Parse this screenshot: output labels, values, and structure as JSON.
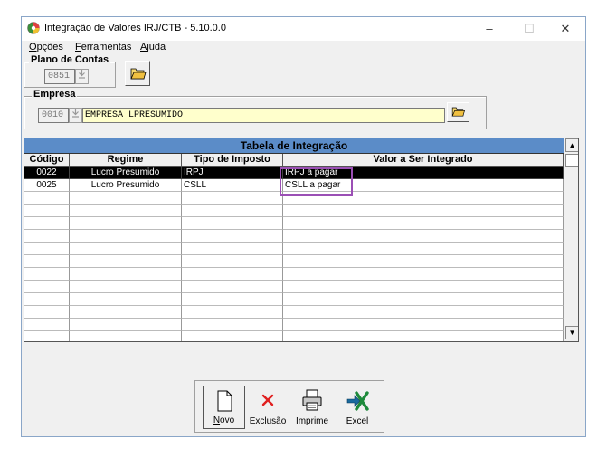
{
  "window": {
    "title": "Integração de Valores IRJ/CTB - 5.10.0.0",
    "minimize": "–",
    "maximize": "☐",
    "close": "✕"
  },
  "menu": [
    {
      "label": "Opções",
      "accel": "O",
      "rest": "pções"
    },
    {
      "label": "Ferramentas",
      "accel": "F",
      "rest": "erramentas"
    },
    {
      "label": "Ajuda",
      "accel": "A",
      "rest": "juda"
    }
  ],
  "plano": {
    "label": "Plano de Contas",
    "code": "0851"
  },
  "empresa": {
    "label": "Empresa",
    "code": "0010",
    "name": "EMPRESA LPRESUMIDO"
  },
  "table": {
    "title": "Tabela de Integração",
    "columns": [
      "Código",
      "Regime",
      "Tipo de Imposto",
      "Valor a Ser Integrado"
    ],
    "rows": [
      {
        "codigo": "0022",
        "regime": "Lucro Presumido",
        "tipo": "IRPJ",
        "valor": "IRPJ a pagar",
        "selected": true
      },
      {
        "codigo": "0025",
        "regime": "Lucro Presumido",
        "tipo": "CSLL",
        "valor": "CSLL a pagar",
        "selected": false
      }
    ],
    "scroll_up": "▲",
    "scroll_down": "▼"
  },
  "buttons": {
    "novo": {
      "label": "Novo",
      "accel": "N",
      "rest": "ovo"
    },
    "exclusao": {
      "label": "Exclusão",
      "pre": "E",
      "accel": "x",
      "rest": "clusão"
    },
    "imprime": {
      "label": "Imprime",
      "accel": "I",
      "rest": "mprime"
    },
    "excel": {
      "label": "Excel",
      "pre": "E",
      "accel": "x",
      "rest": "cel"
    }
  },
  "colors": {
    "grid_title_bg": "#5b8cc8",
    "highlight": "#9b4fb5",
    "input_bg": "#ffffcc"
  }
}
